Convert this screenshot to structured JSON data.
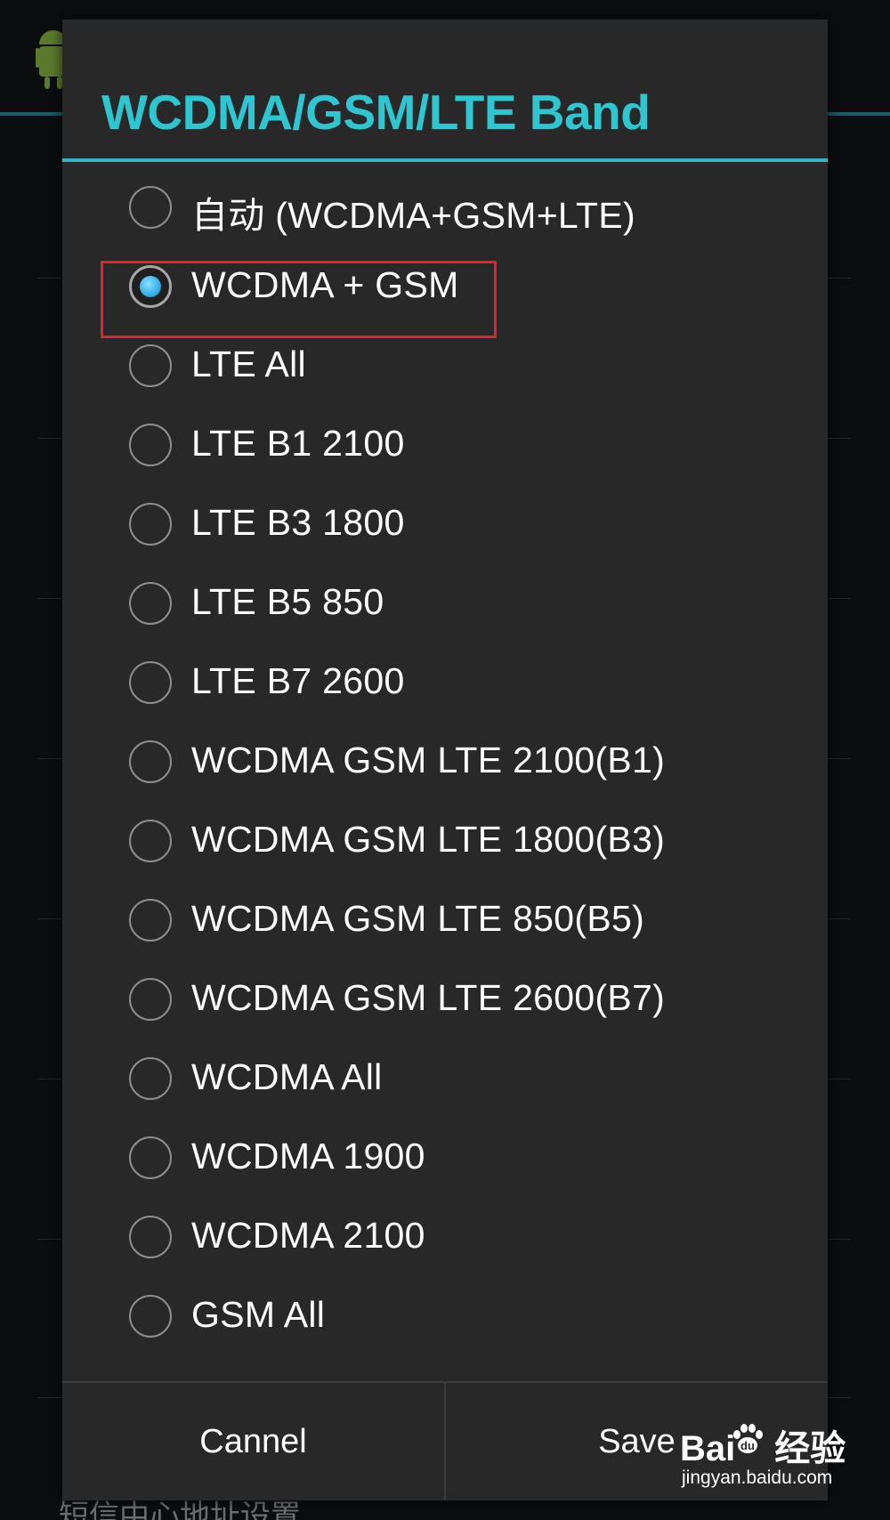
{
  "dialog": {
    "title": "WCDMA/GSM/LTE Band",
    "options": [
      {
        "label": "自动 (WCDMA+GSM+LTE)",
        "checked": false
      },
      {
        "label": "WCDMA + GSM",
        "checked": true
      },
      {
        "label": "LTE All",
        "checked": false
      },
      {
        "label": "LTE B1 2100",
        "checked": false
      },
      {
        "label": "LTE B3 1800",
        "checked": false
      },
      {
        "label": "LTE B5 850",
        "checked": false
      },
      {
        "label": "LTE B7 2600",
        "checked": false
      },
      {
        "label": "WCDMA GSM LTE 2100(B1)",
        "checked": false
      },
      {
        "label": "WCDMA GSM LTE 1800(B3)",
        "checked": false
      },
      {
        "label": "WCDMA GSM LTE 850(B5)",
        "checked": false
      },
      {
        "label": "WCDMA GSM LTE 2600(B7)",
        "checked": false
      },
      {
        "label": "WCDMA All",
        "checked": false
      },
      {
        "label": "WCDMA 1900",
        "checked": false
      },
      {
        "label": "WCDMA 2100",
        "checked": false
      },
      {
        "label": "GSM All",
        "checked": false
      }
    ],
    "buttons": {
      "cancel_label": "Cannel",
      "save_label": "Save"
    }
  },
  "background": {
    "bottom_text": "短信中心地址设置"
  },
  "watermark": {
    "brand_left": "Bai",
    "brand_right": "经验",
    "url": "jingyan.baidu.com"
  },
  "colors": {
    "title": "#2ec6d0",
    "accent_rule": "#33b5c3",
    "dialog_bg": "#282828",
    "radio_checked": "#3bb3ea",
    "highlight_box": "#e0232d"
  },
  "icons": [
    "android-app-icon",
    "radio-unchecked-icon",
    "radio-checked-icon",
    "baidu-paw-icon"
  ]
}
